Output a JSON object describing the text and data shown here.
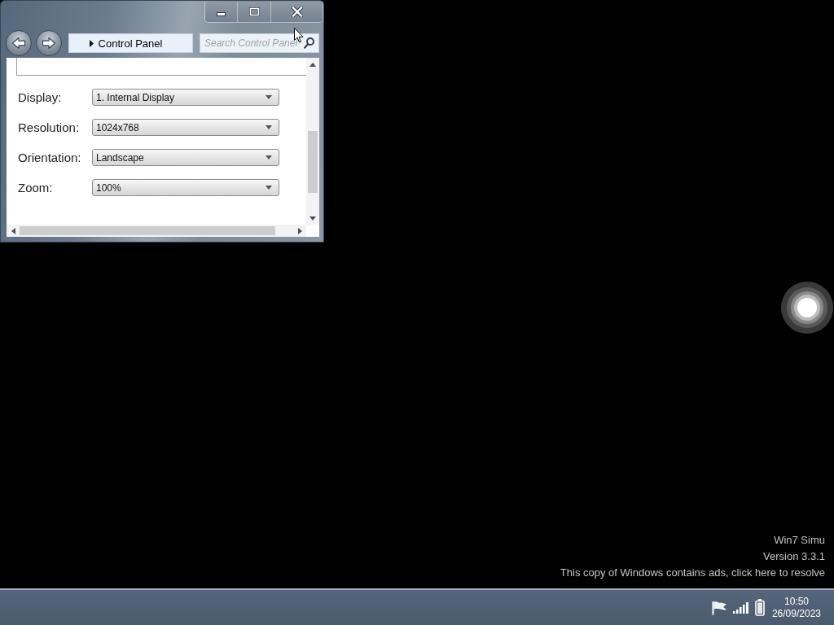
{
  "window": {
    "address_bar": {
      "location": "Control Panel"
    },
    "search": {
      "placeholder": "Search Control Panel"
    },
    "settings": [
      {
        "label": "Display:",
        "value": "1. Internal Display"
      },
      {
        "label": "Resolution:",
        "value": "1024x768"
      },
      {
        "label": "Orientation:",
        "value": "Landscape"
      },
      {
        "label": "Zoom:",
        "value": "100%"
      }
    ]
  },
  "desktop_notice": [
    "Win7 Simu",
    "Version 3.3.1",
    "This copy of Windows contains ads, click here to resolve"
  ],
  "taskbar": {
    "clock": {
      "time": "10:50",
      "date": "26/09/2023"
    }
  }
}
